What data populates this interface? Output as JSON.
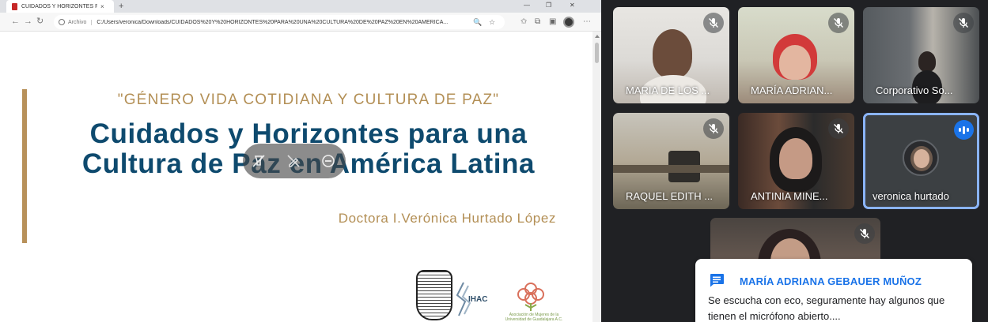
{
  "browser": {
    "tab_title": "CUIDADOS Y HORIZONTES PARA UNA",
    "tab_close": "×",
    "new_tab": "+",
    "scheme_label": "Archivo",
    "url": "C:/Users/veronica/Downloads/CUIDADOS%20Y%20HORIZONTES%20PARA%20UNA%20CULTURA%20DE%20PAZ%20EN%20AMÉRICA...",
    "back_glyph": "←",
    "forward_glyph": "→",
    "reload_glyph": "↻"
  },
  "slide": {
    "subtitle": "\"GÉNERO VIDA COTIDIANA Y CULTURA DE PAZ\"",
    "title_line1": "Cuidados y Horizontes para una",
    "title_line2": "Cultura de Paz en América Latina",
    "author": "Doctora I.Verónica Hurtado López",
    "logo_ihac": "IHAC",
    "logo_amu": "Asociación de Mujeres de la Universidad de Guadalajara A.C."
  },
  "meeting": {
    "participants": [
      {
        "name": "MARIA DE LOS ...",
        "mic": "muted"
      },
      {
        "name": "MARÍA ADRIAN...",
        "mic": "muted"
      },
      {
        "name": "Corporativo So...",
        "mic": "muted"
      },
      {
        "name": "RAQUEL EDITH ...",
        "mic": "muted"
      },
      {
        "name": "ANTINIA MINE...",
        "mic": "muted"
      },
      {
        "name": "veronica hurtado",
        "mic": "speaking"
      },
      {
        "name": "",
        "mic": "muted"
      }
    ],
    "chat_toast": {
      "sender": "MARÍA ADRIANA GEBAUER MUÑOZ",
      "message": "Se escucha con eco, seguramente hay algunos que tienen el micrófono abierto...."
    }
  },
  "colors": {
    "slide_gold": "#b38f55",
    "slide_navy": "#0e4a6e",
    "meet_bg": "#202124",
    "meet_accent": "#1a73e8",
    "active_outline": "#8ab4f8"
  }
}
